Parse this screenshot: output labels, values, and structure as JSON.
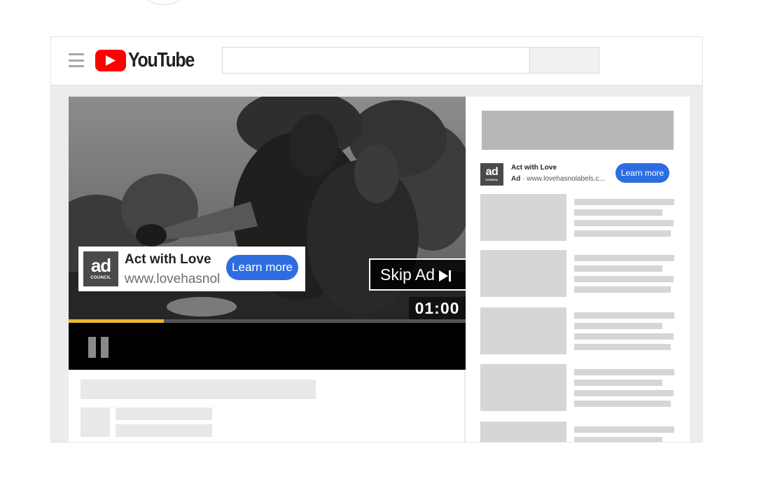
{
  "masthead": {
    "logo_text": "YouTube",
    "search": {
      "placeholder": "",
      "value": ""
    }
  },
  "player": {
    "progress": 0.24,
    "ad": {
      "title": "Act with Love",
      "url": "www.lovehasnol",
      "cta": "Learn more",
      "logo_big": "ad",
      "logo_small": "COUNCIL"
    },
    "skip_label": "Skip Ad",
    "timer": "01:00"
  },
  "sidebar": {
    "ad": {
      "title": "Act with Love",
      "badge": "Ad",
      "url": " · www.lovehasnolabels.c...",
      "cta": "Learn more",
      "logo_big": "ad",
      "logo_small": "COUNCIL"
    }
  },
  "colors": {
    "accent_blue": "#2d6de0",
    "youtube_red": "#ff0000",
    "progress_yellow": "#e8b931"
  }
}
